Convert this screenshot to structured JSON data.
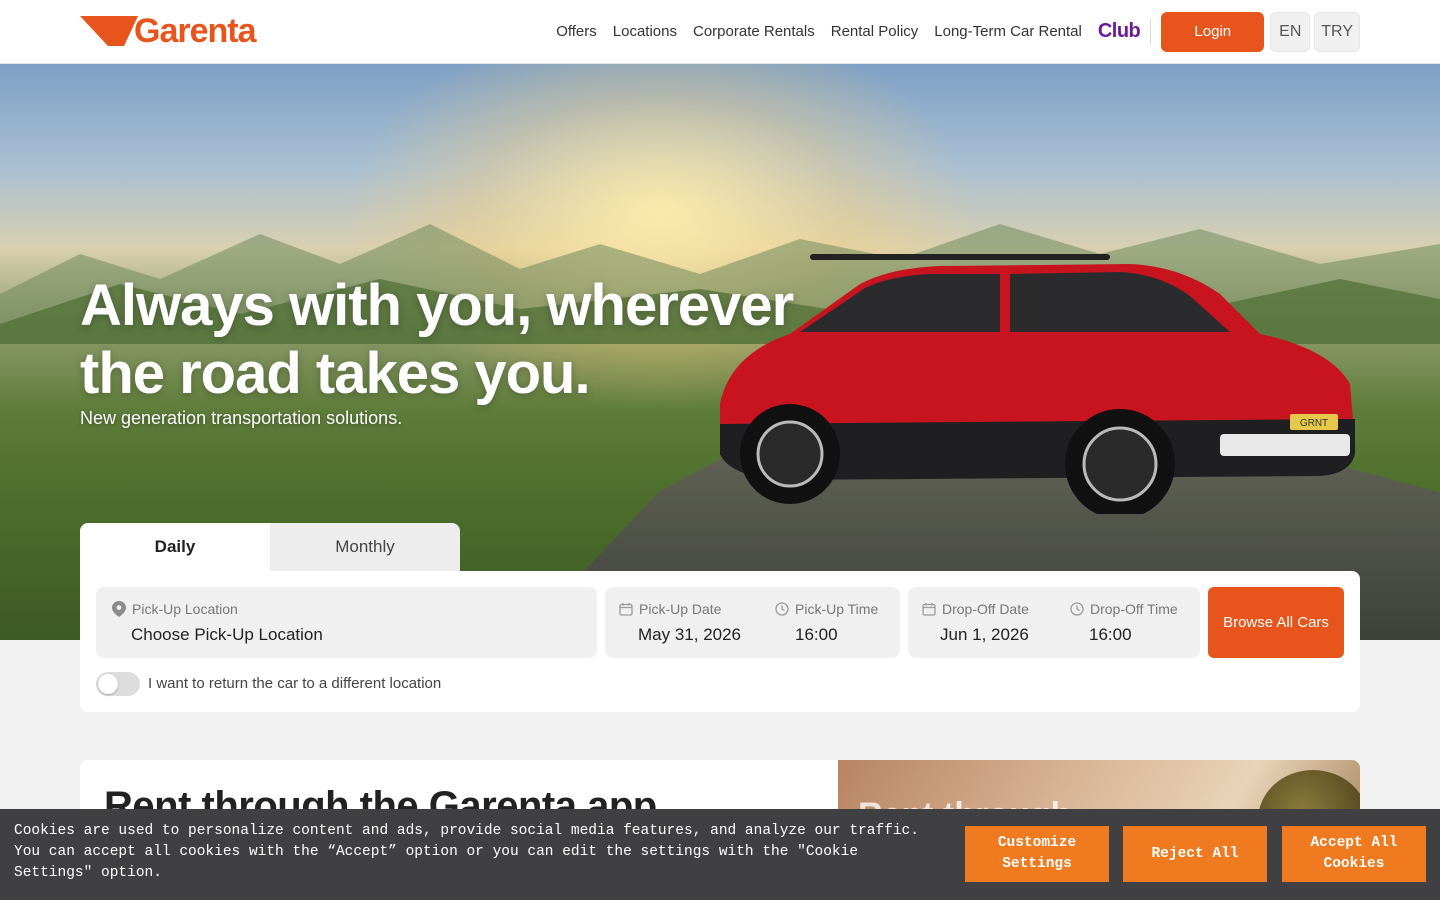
{
  "header": {
    "logo_text": "Garenta",
    "nav": [
      "Offers",
      "Locations",
      "Corporate Rentals",
      "Rental Policy",
      "Long-Term Car Rental"
    ],
    "club_label": "Club",
    "login_label": "Login",
    "language": "EN",
    "currency": "TRY"
  },
  "hero": {
    "title": "Always with you, wherever the road takes you.",
    "subtitle": "New generation transportation solutions.",
    "plate": "GRNT"
  },
  "booking": {
    "tabs": [
      "Daily",
      "Monthly"
    ],
    "active_tab": "Daily",
    "pickup_location": {
      "label": "Pick-Up Location",
      "value": "Choose Pick-Up Location"
    },
    "pickup_date": {
      "label": "Pick-Up Date",
      "value": "May 31, 2026"
    },
    "pickup_time": {
      "label": "Pick-Up Time",
      "value": "16:00"
    },
    "dropoff_date": {
      "label": "Drop-Off Date",
      "value": "Jun 1, 2026"
    },
    "dropoff_time": {
      "label": "Drop-Off Time",
      "value": "16:00"
    },
    "browse_label": "Browse All Cars",
    "different_location_label": "I want to return the car to a different location",
    "different_location_enabled": false
  },
  "app_section": {
    "title": "Rent through the Garenta app",
    "image_title": "Rent through"
  },
  "cookie": {
    "text": "Cookies are used to personalize content and ads, provide social media features, and analyze our traffic. You can accept all cookies with the “Accept” option or you can edit the settings with the \"Cookie Settings\" option.",
    "customize_label": "Customize Settings",
    "reject_label": "Reject All",
    "accept_label": "Accept All Cookies"
  },
  "colors": {
    "brand": "#e8551c",
    "club": "#6a1b9a",
    "cookie_bg": "#404042",
    "cookie_button": "#f07a1f"
  }
}
